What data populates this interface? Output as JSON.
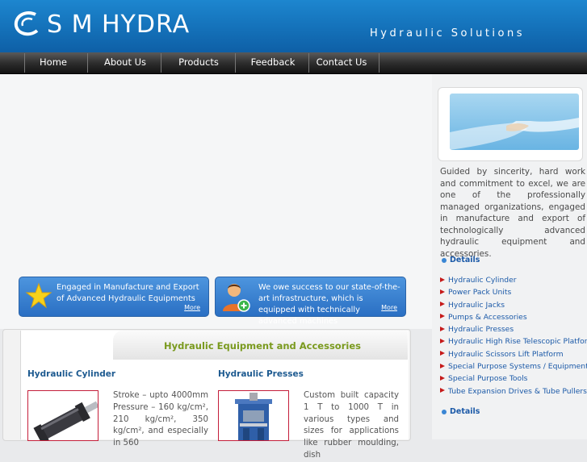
{
  "header": {
    "logo_text": "S M HYDRA",
    "tagline": "Hydraulic Solutions"
  },
  "nav": {
    "items": [
      "Home",
      "About Us",
      "Products",
      "Feedback",
      "Contact Us"
    ]
  },
  "banners": {
    "left_text": "Engaged in Manufacture and Export of Advanced Hydraulic Equipments",
    "left_more": "More",
    "right_text": "We owe success to our state-of-the-art infrastructure, which is equipped with technically advanced machines",
    "right_more": "More"
  },
  "sidebar": {
    "intro": "Guided by sincerity, hard work and commitment to excel, we are one of the professionally managed organizations, engaged in manufacture and export of technologically advanced hydraulic equipment and accessories.",
    "details_label": "Details",
    "products": [
      "Hydraulic Cylinder",
      "Power Pack Units",
      "Hydraulic Jacks",
      "Pumps & Accessories",
      "Hydraulic Presses",
      "Hydraulic High Rise Telescopic Platform",
      "Hydraulic Scissors Lift Platform",
      "Special Purpose Systems / Equipments",
      "Special Purpose Tools",
      "Tube Expansion Drives & Tube Pullers"
    ],
    "details_label_bottom": "Details"
  },
  "section": {
    "title": "Hydraulic Equipment and Accessories",
    "cards": [
      {
        "title": "Hydraulic Cylinder",
        "desc": "Stroke – upto 4000mm Pressure – 160 kg/cm², 210 kg/cm², 350 kg/cm², and especially in 560"
      },
      {
        "title": "Hydraulic Presses",
        "desc": "Custom built capacity 1 T to 1000 T in various types and sizes for applications like rubber moulding, dish"
      }
    ]
  },
  "colors": {
    "header_blue": "#1471b9",
    "nav_dark": "#2e2e2e",
    "link_blue": "#1c5aa8",
    "bullet_red": "#c61a1a",
    "section_title_green": "#7a9a1e"
  }
}
